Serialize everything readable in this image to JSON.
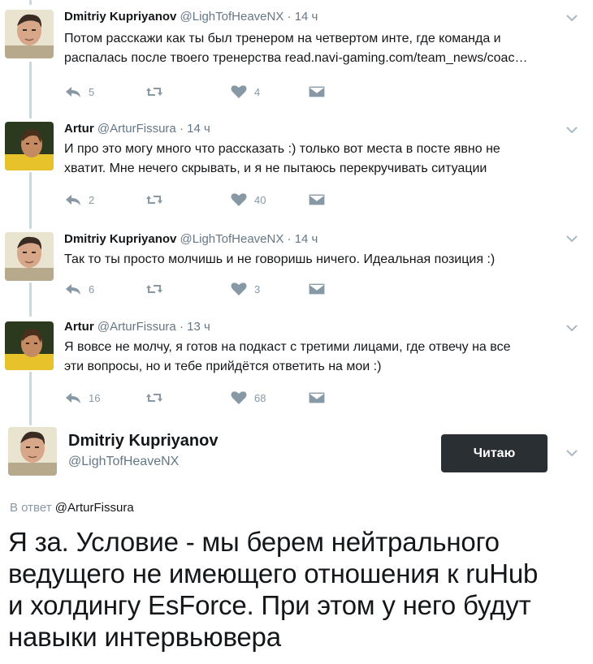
{
  "tweets": [
    {
      "name": "Dmitriy Kupriyanov",
      "handle": "@LighTofHeaveNX",
      "time": "14 ч",
      "text": "Потом расскажи как ты был тренером на четвертом инте, где команда и\nраспалась после твоего тренерства read.navi-gaming.com/team_news/coac…",
      "replies": "5",
      "retweets": "",
      "likes": "4"
    },
    {
      "name": "Artur",
      "handle": "@ArturFissura",
      "time": "14 ч",
      "text": "И про это могу много что рассказать :) только вот места в посте  явно не\nхватит. Мне нечего скрывать, и я не пытаюсь перекручивать ситуации",
      "replies": "2",
      "retweets": "",
      "likes": "40"
    },
    {
      "name": "Dmitriy Kupriyanov",
      "handle": "@LighTofHeaveNX",
      "time": "14 ч",
      "text": "Так то ты просто молчишь и не говоришь ничего. Идеальная позиция :)",
      "replies": "6",
      "retweets": "",
      "likes": "3"
    },
    {
      "name": "Artur",
      "handle": "@ArturFissura",
      "time": "13 ч",
      "text": "Я вовсе не молчу, я готов на подкаст с третими лицами, где отвечу на все\nэти вопросы, но и тебе прийдётся ответить на мои :)",
      "replies": "16",
      "retweets": "",
      "likes": "68"
    }
  ],
  "main": {
    "name": "Dmitriy Kupriyanov",
    "handle": "@LighTofHeaveNX",
    "follow_label": "Читаю",
    "reply_prefix": "В ответ",
    "reply_to": "@ArturFissura",
    "text": "Я за. Условие - мы берем нейтрального\nведущего не имеющего отношения к ruHub\nи холдингу EsForce. При этом у него будут\nнавыки интервьювера"
  },
  "icons": {
    "reply": "reply-icon",
    "retweet": "retweet-icon",
    "like": "heart-icon",
    "dm": "direct-message-icon",
    "caret": "chevron-down-icon"
  },
  "colors": {
    "text": "#14171a",
    "meta": "#657786",
    "action": "#8899a6",
    "thread_line": "#ccd6dd",
    "button_bg": "#292f33"
  }
}
